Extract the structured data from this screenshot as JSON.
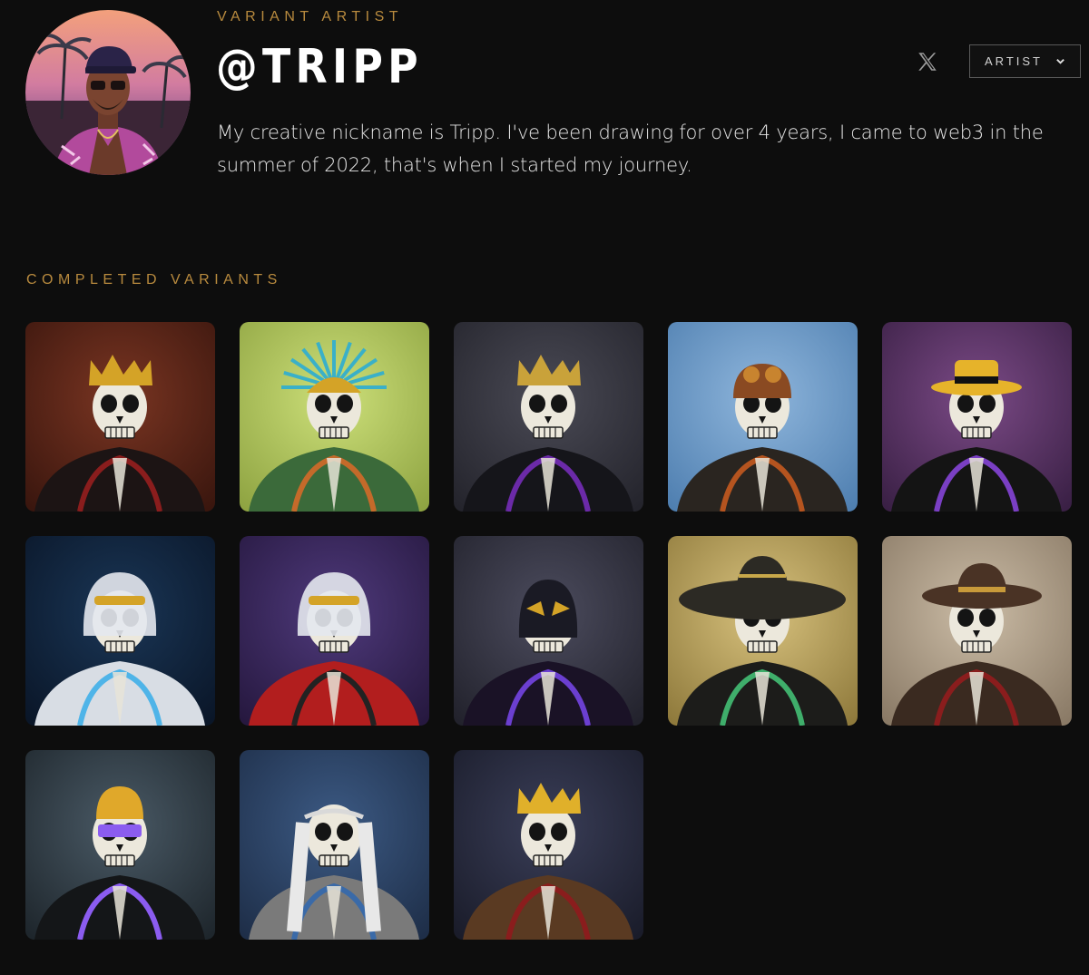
{
  "artist": {
    "eyebrow": "VARIANT ARTIST",
    "handle": "@TRIPP",
    "bio": "My creative nickname is Tripp. I've been drawing for over 4 years, I came to web3 in the summer of 2022, that's when I started my journey.",
    "avatar_icon": "avatar-portrait",
    "social_icon": "x-logo-icon"
  },
  "role_select": {
    "label": "ARTIST",
    "icon": "chevron-down-icon"
  },
  "variants": {
    "title": "COMPLETED VARIANTS",
    "items": [
      {
        "name": "red-hooded-king-skeleton",
        "bg": "#7a3522",
        "bg2": "#3a160e",
        "accent": "#d4a327",
        "garment": "#1c1414",
        "trim": "#8a1d1d",
        "headwear": "crown"
      },
      {
        "name": "aztec-feather-skeleton",
        "bg": "#cde07a",
        "bg2": "#8fa442",
        "accent": "#d4a327",
        "garment": "#3b6a3a",
        "trim": "#c46a2a",
        "headwear": "feathers"
      },
      {
        "name": "dark-knight-skeleton",
        "bg": "#4a4a55",
        "bg2": "#24242c",
        "accent": "#c9a23a",
        "garment": "#15151a",
        "trim": "#6b2aa8",
        "headwear": "crown"
      },
      {
        "name": "aviator-snake-skeleton",
        "bg": "#8fb6dc",
        "bg2": "#4f7fb0",
        "accent": "#c8842f",
        "garment": "#2a2520",
        "trim": "#b5541f",
        "headwear": "aviator"
      },
      {
        "name": "fedora-tuxedo-skeleton",
        "bg": "#7b4a86",
        "bg2": "#3a2045",
        "accent": "#e6b32a",
        "garment": "#141414",
        "trim": "#7a3fc4",
        "headwear": "fedora"
      },
      {
        "name": "space-helmet-skeleton",
        "bg": "#1a3656",
        "bg2": "#0a1628",
        "accent": "#d4a327",
        "garment": "#d8dde4",
        "trim": "#4fb4e8",
        "headwear": "helmet"
      },
      {
        "name": "racing-mech-skeleton",
        "bg": "#4f3a7c",
        "bg2": "#26183f",
        "accent": "#d4a327",
        "garment": "#b21e1e",
        "trim": "#222",
        "headwear": "helmet"
      },
      {
        "name": "luchador-skeleton",
        "bg": "#4c4c5e",
        "bg2": "#22222c",
        "accent": "#d4a327",
        "garment": "#1a1226",
        "trim": "#6b3fd0",
        "headwear": "mask"
      },
      {
        "name": "sombrero-skeleton",
        "bg": "#d8c27e",
        "bg2": "#8f7a3c",
        "accent": "#2c2a24",
        "garment": "#1c1c1a",
        "trim": "#3fae6b",
        "headwear": "sombrero"
      },
      {
        "name": "cowboy-skeleton",
        "bg": "#cbbca6",
        "bg2": "#8a7a66",
        "accent": "#4a3325",
        "garment": "#3a2a20",
        "trim": "#8a1d1d",
        "headwear": "cowboy"
      },
      {
        "name": "hoodie-hodl-skeleton",
        "bg": "#4a5a66",
        "bg2": "#1e262c",
        "accent": "#e0a82a",
        "garment": "#141618",
        "trim": "#8b5cf0",
        "headwear": "beanie"
      },
      {
        "name": "elven-skeleton",
        "bg": "#3c5a84",
        "bg2": "#1e2e48",
        "accent": "#d9d9d9",
        "garment": "#7a7a7a",
        "trim": "#3a6aa8",
        "headwear": "circlet"
      },
      {
        "name": "crowned-sword-king-skeleton",
        "bg": "#3a3e58",
        "bg2": "#1a1c2a",
        "accent": "#e0b02a",
        "garment": "#5a3a22",
        "trim": "#8a1d1d",
        "headwear": "crown"
      }
    ]
  }
}
